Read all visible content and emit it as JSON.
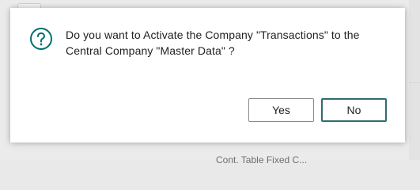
{
  "background": {
    "footer_text": "Cont. Table Fixed C..."
  },
  "dialog": {
    "icon": "question-icon",
    "message": "Do you want to Activate the Company \"Transactions\" to the Central Company \"Master Data\" ?",
    "buttons": {
      "yes_label": "Yes",
      "no_label": "No"
    }
  },
  "colors": {
    "accent": "#00706c",
    "default_button_border": "#2f6b71",
    "text": "#212121"
  }
}
